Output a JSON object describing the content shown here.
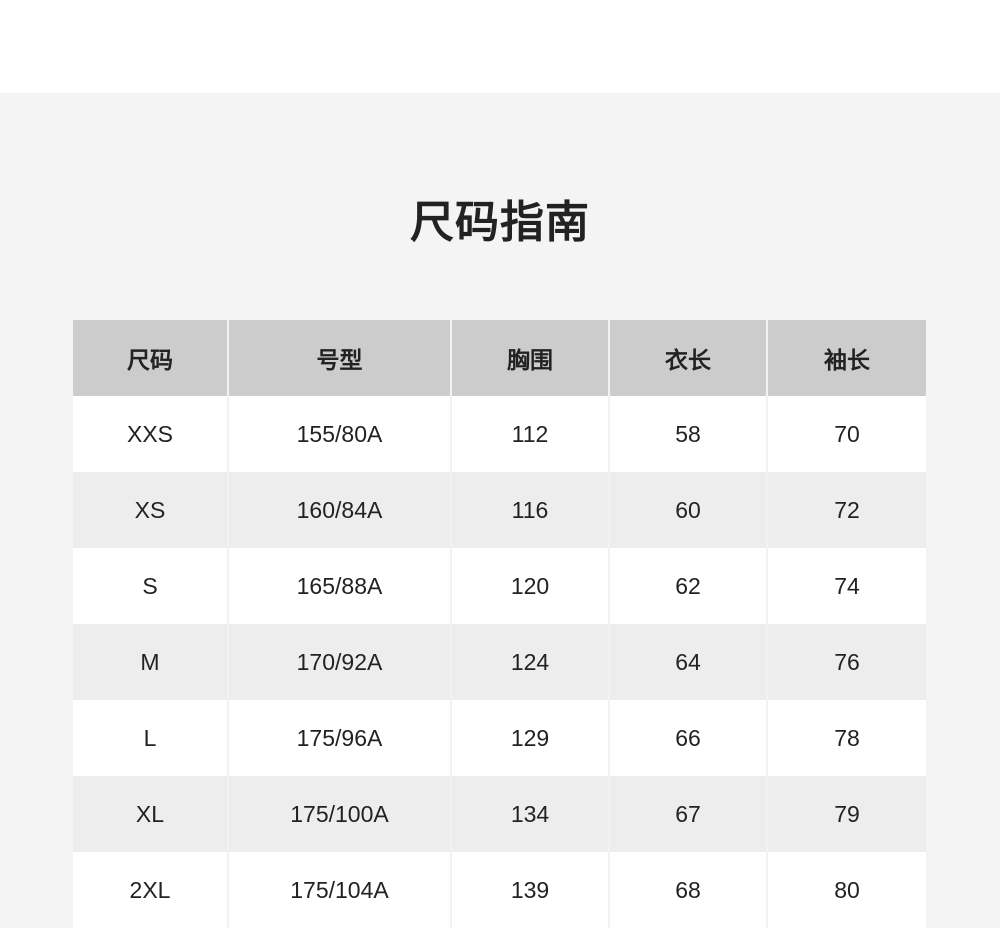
{
  "title": "尺码指南",
  "table": {
    "headers": [
      "尺码",
      "号型",
      "胸围",
      "衣长",
      "袖长"
    ],
    "rows": [
      [
        "XXS",
        "155/80A",
        "112",
        "58",
        "70"
      ],
      [
        "XS",
        "160/84A",
        "116",
        "60",
        "72"
      ],
      [
        "S",
        "165/88A",
        "120",
        "62",
        "74"
      ],
      [
        "M",
        "170/92A",
        "124",
        "64",
        "76"
      ],
      [
        "L",
        "175/96A",
        "129",
        "66",
        "78"
      ],
      [
        "XL",
        "175/100A",
        "134",
        "67",
        "79"
      ],
      [
        "2XL",
        "175/104A",
        "139",
        "68",
        "80"
      ]
    ]
  },
  "colors": {
    "page_background": "#f4f4f4",
    "header_background": "#cccccc",
    "row_odd": "#ffffff",
    "row_even": "#ededed",
    "text": "#222222"
  }
}
